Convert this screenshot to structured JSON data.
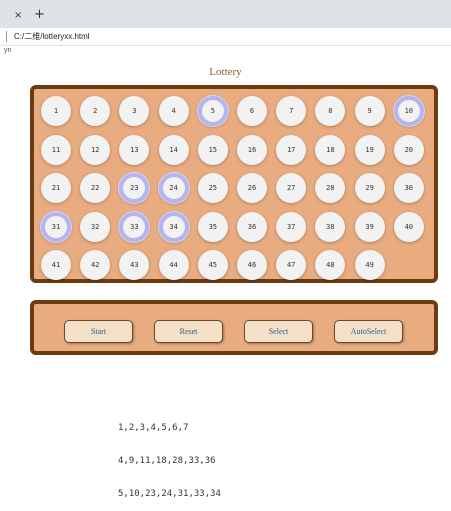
{
  "browser": {
    "tab_close": "×",
    "tab_new": "+",
    "address": "C:/二维/lotteryxx.html",
    "bookmark": "yn"
  },
  "page": {
    "title": "Lottery"
  },
  "balls": [
    {
      "n": "1",
      "selected": false
    },
    {
      "n": "2",
      "selected": false
    },
    {
      "n": "3",
      "selected": false
    },
    {
      "n": "4",
      "selected": false
    },
    {
      "n": "5",
      "selected": true
    },
    {
      "n": "6",
      "selected": false
    },
    {
      "n": "7",
      "selected": false
    },
    {
      "n": "8",
      "selected": false
    },
    {
      "n": "9",
      "selected": false
    },
    {
      "n": "10",
      "selected": true
    },
    {
      "n": "11",
      "selected": false
    },
    {
      "n": "12",
      "selected": false
    },
    {
      "n": "13",
      "selected": false
    },
    {
      "n": "14",
      "selected": false
    },
    {
      "n": "15",
      "selected": false
    },
    {
      "n": "16",
      "selected": false
    },
    {
      "n": "17",
      "selected": false
    },
    {
      "n": "18",
      "selected": false
    },
    {
      "n": "19",
      "selected": false
    },
    {
      "n": "20",
      "selected": false
    },
    {
      "n": "21",
      "selected": false
    },
    {
      "n": "22",
      "selected": false
    },
    {
      "n": "23",
      "selected": true
    },
    {
      "n": "24",
      "selected": true
    },
    {
      "n": "25",
      "selected": false
    },
    {
      "n": "26",
      "selected": false
    },
    {
      "n": "27",
      "selected": false
    },
    {
      "n": "28",
      "selected": false
    },
    {
      "n": "29",
      "selected": false
    },
    {
      "n": "30",
      "selected": false
    },
    {
      "n": "31",
      "selected": true
    },
    {
      "n": "32",
      "selected": false
    },
    {
      "n": "33",
      "selected": true
    },
    {
      "n": "34",
      "selected": true
    },
    {
      "n": "35",
      "selected": false
    },
    {
      "n": "36",
      "selected": false
    },
    {
      "n": "37",
      "selected": false
    },
    {
      "n": "38",
      "selected": false
    },
    {
      "n": "39",
      "selected": false
    },
    {
      "n": "40",
      "selected": false
    },
    {
      "n": "41",
      "selected": false
    },
    {
      "n": "42",
      "selected": false
    },
    {
      "n": "43",
      "selected": false
    },
    {
      "n": "44",
      "selected": false
    },
    {
      "n": "45",
      "selected": false
    },
    {
      "n": "46",
      "selected": false
    },
    {
      "n": "47",
      "selected": false
    },
    {
      "n": "48",
      "selected": false
    },
    {
      "n": "49",
      "selected": false
    }
  ],
  "controls": {
    "start": "Start",
    "reset": "Reset",
    "select": "Select",
    "autoselect": "AutoSelect"
  },
  "results": [
    "1,2,3,4,5,6,7",
    "4,9,11,18,28,33,36",
    "5,10,23,24,31,33,34"
  ]
}
